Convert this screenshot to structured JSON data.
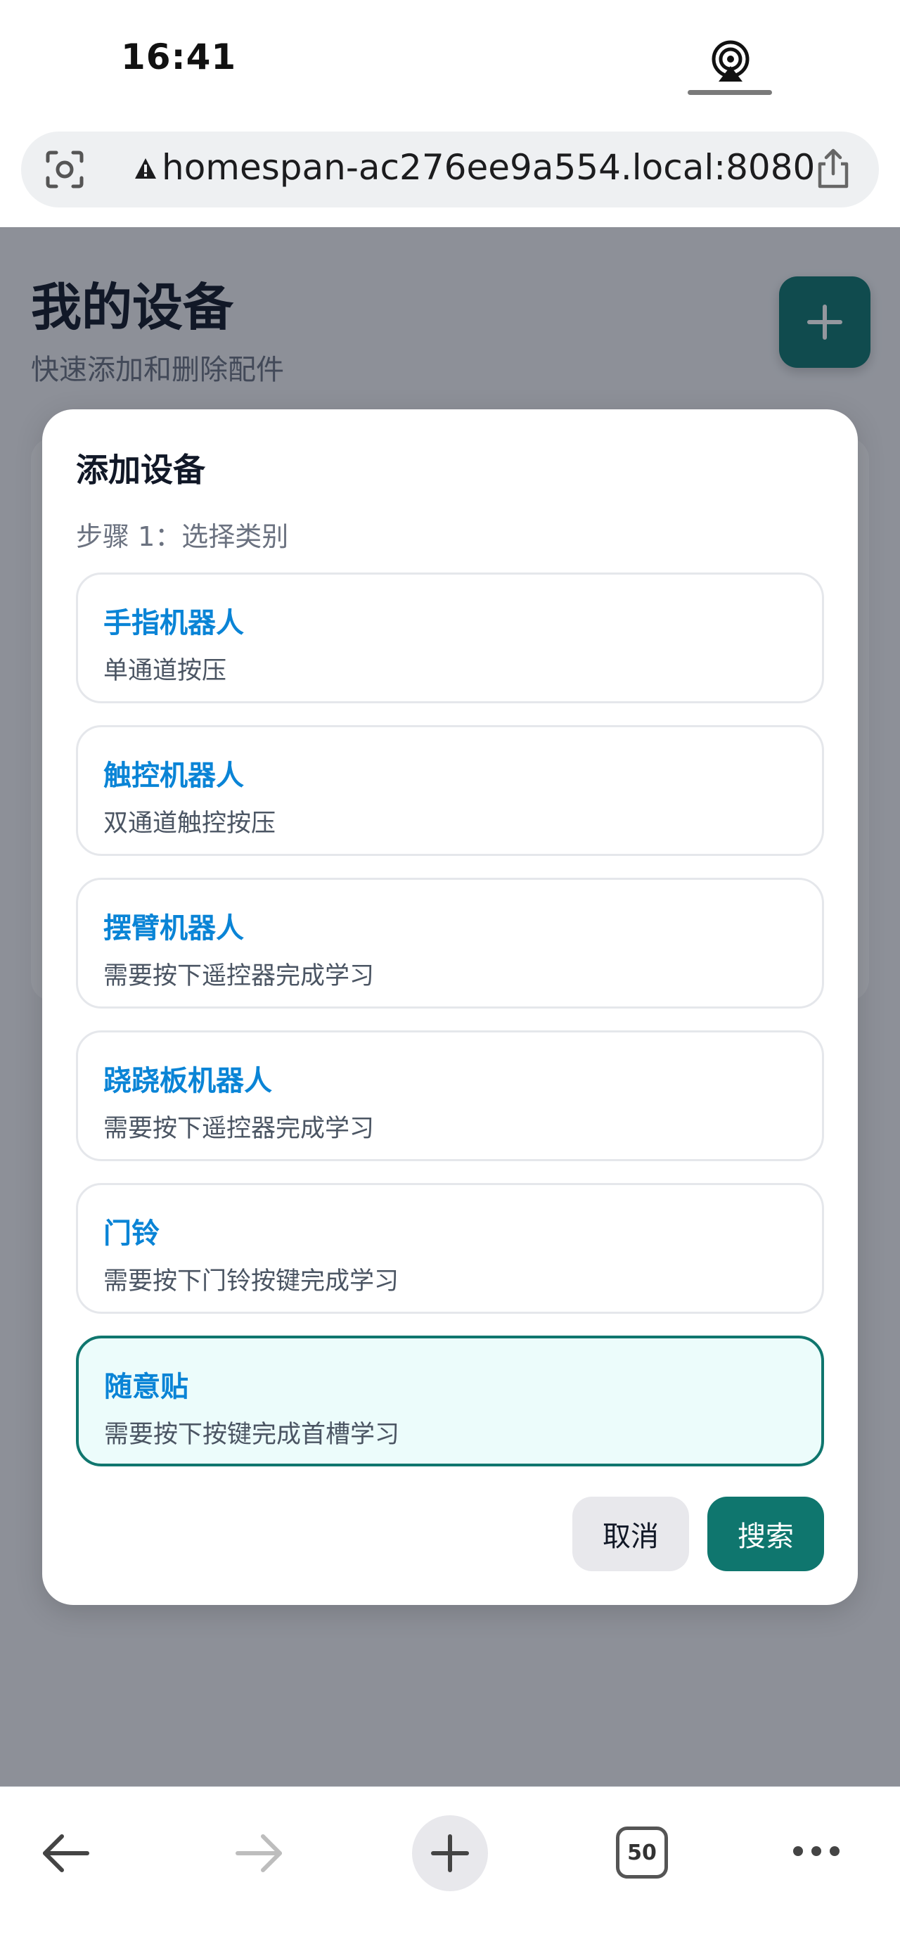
{
  "status_bar": {
    "time": "16:41"
  },
  "browser": {
    "url": "homespan-ac276ee9a554.local:8080",
    "tab_count": "50"
  },
  "page": {
    "title": "我的设备",
    "subtitle": "快速添加和删除配件"
  },
  "modal": {
    "title": "添加设备",
    "step": "步骤 1：选择类别",
    "options": [
      {
        "name": "手指机器人",
        "desc": "单通道按压",
        "selected": false
      },
      {
        "name": "触控机器人",
        "desc": "双通道触控按压",
        "selected": false
      },
      {
        "name": "摆臂机器人",
        "desc": "需要按下遥控器完成学习",
        "selected": false
      },
      {
        "name": "跷跷板机器人",
        "desc": "需要按下遥控器完成学习",
        "selected": false
      },
      {
        "name": "门铃",
        "desc": "需要按下门铃按键完成学习",
        "selected": false
      },
      {
        "name": "随意贴",
        "desc": "需要按下按键完成首槽学习",
        "selected": true
      }
    ],
    "cancel_label": "取消",
    "search_label": "搜索"
  },
  "colors": {
    "accent": "#0f766e",
    "option_name": "#0a84d6",
    "selected_bg": "#ecfcfb"
  },
  "icons": {
    "status": [
      "airplay-icon"
    ],
    "url_bar": [
      "lens-icon",
      "warning-icon",
      "share-icon"
    ],
    "toolbar": [
      "back-arrow-icon",
      "forward-arrow-icon",
      "plus-icon",
      "tabs-icon",
      "more-icon"
    ]
  }
}
